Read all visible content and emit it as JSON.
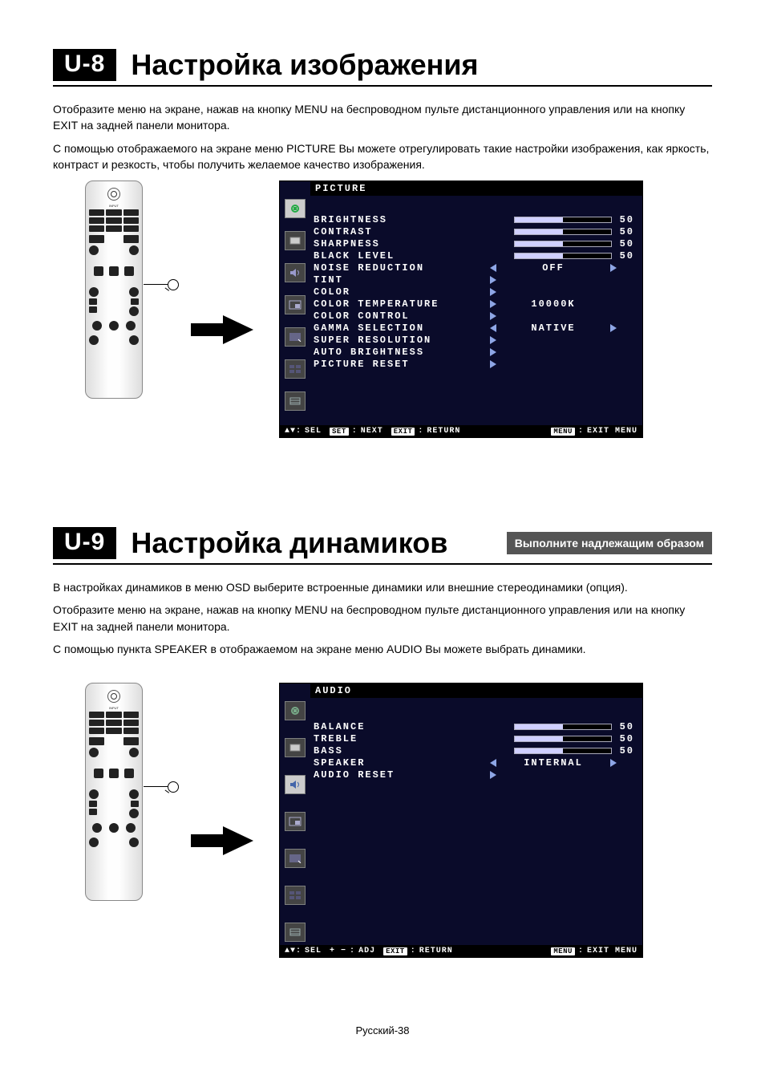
{
  "section1": {
    "tag": "U-8",
    "title": "Настройка изображения",
    "para1": "Отобразите меню на экране, нажав на кнопку MENU на беспроводном пульте дистанционного управления или на кнопку EXIT на задней панели монитора.",
    "para2": "С помощью отображаемого на экране меню PICTURE Вы можете отрегулировать такие настройки изображения, как яркость, контраст и резкость, чтобы получить желаемое качество изображения."
  },
  "section2": {
    "tag": "U-9",
    "title": "Настройка динамиков",
    "badge": "Выполните надлежащим образом",
    "para1": "В настройках динамиков в меню OSD выберите встроенные динамики или внешние стереодинамики (опция).",
    "para2": "Отобразите меню на экране, нажав на кнопку MENU на беспроводном пульте дистанционного управления или на кнопку EXIT на задней панели монитора.",
    "para3": "С помощью пункта SPEAKER в отображаемом на экране меню AUDIO Вы можете выбрать динамики."
  },
  "osd_picture": {
    "title": "PICTURE",
    "items": [
      {
        "label": "BRIGHTNESS",
        "type": "bar",
        "value": "50"
      },
      {
        "label": "CONTRAST",
        "type": "bar",
        "value": "50"
      },
      {
        "label": "SHARPNESS",
        "type": "bar",
        "value": "50"
      },
      {
        "label": "BLACK LEVEL",
        "type": "bar",
        "value": "50"
      },
      {
        "label": "NOISE REDUCTION",
        "type": "select",
        "value": "OFF"
      },
      {
        "label": "TINT",
        "type": "goto"
      },
      {
        "label": "COLOR",
        "type": "goto"
      },
      {
        "label": "COLOR TEMPERATURE",
        "type": "text",
        "value": "10000K"
      },
      {
        "label": "COLOR CONTROL",
        "type": "goto"
      },
      {
        "label": "GAMMA SELECTION",
        "type": "select",
        "value": "NATIVE"
      },
      {
        "label": "SUPER RESOLUTION",
        "type": "goto"
      },
      {
        "label": "AUTO BRIGHTNESS",
        "type": "goto"
      },
      {
        "label": "PICTURE RESET",
        "type": "goto"
      }
    ],
    "footer": {
      "sel": "SEL",
      "nextKey": "SET",
      "next": "NEXT",
      "exitKey": "EXIT",
      "return": "RETURN",
      "menuKey": "MENU",
      "exitMenu": "EXIT MENU"
    }
  },
  "osd_audio": {
    "title": "AUDIO",
    "items": [
      {
        "label": "BALANCE",
        "type": "bar",
        "value": "50"
      },
      {
        "label": "TREBLE",
        "type": "bar",
        "value": "50"
      },
      {
        "label": "BASS",
        "type": "bar",
        "value": "50"
      },
      {
        "label": "SPEAKER",
        "type": "select",
        "value": "INTERNAL"
      },
      {
        "label": "AUDIO RESET",
        "type": "goto"
      }
    ],
    "footer": {
      "sel": "SEL",
      "adjKey": "+ −",
      "adj": "ADJ",
      "exitKey": "EXIT",
      "return": "RETURN",
      "menuKey": "MENU",
      "exitMenu": "EXIT MENU"
    }
  },
  "footer": "Русский-38"
}
